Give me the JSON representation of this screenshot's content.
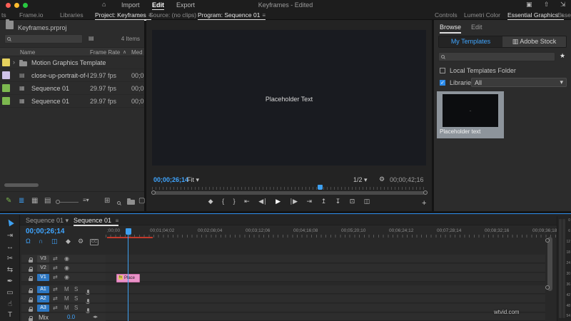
{
  "colors": {
    "accent_blue": "#2d8ceb",
    "timecode_blue": "#3fa5ff",
    "clip_pink": "#ea93c8",
    "fx_yellow": "#e3cf4e",
    "render_red": "#c0392b",
    "mac_close": "#ff5f57",
    "mac_minimize": "#febc2e",
    "mac_zoom": "#28c840",
    "label_yellow": "#e6d25e",
    "label_lavender": "#cfc3e8",
    "label_green": "#7cb84f"
  },
  "icons": {
    "home": "⌂",
    "workspaces": "▣",
    "quick_export": "⇧",
    "fullscreen": "⇲",
    "panel_menu": "≡",
    "overflow": "»",
    "caret_down": "▾",
    "caret_up": "∧",
    "disclosure": "›",
    "star": "★",
    "check": "✓",
    "wrench": "⚙",
    "plus": "+",
    "marker": "◆",
    "snap": "Ω",
    "linked_selection": "∩",
    "nest": "◫",
    "cc_badge": "CC",
    "eye": "◉",
    "sync_lock": "⇄",
    "kf_nav": "◂▸",
    "clip": "▤",
    "sequence": "▦",
    "filter": "▤",
    "stock": "▥"
  },
  "topbar": {
    "menu": [
      "Import",
      "Edit",
      "Export"
    ],
    "title": "Keyframes - Edited"
  },
  "panel_tabs": {
    "left": [
      "ts",
      "Frame.io",
      "Libraries",
      "Project: Keyframes"
    ],
    "center": [
      "Source: (no clips)",
      "Program: Sequence 01"
    ],
    "right": [
      "Controls",
      "Lumetri Color",
      "Essential Graphics",
      "Esse"
    ]
  },
  "project": {
    "filename": "Keyframes.prproj",
    "items_count": "4 Items",
    "columns": [
      "Name",
      "Frame Rate",
      "Med"
    ],
    "rows": [
      {
        "name": "Motion Graphics Template",
        "rate": "",
        "media": ""
      },
      {
        "name": "close-up-portrait-of-blue-an",
        "rate": "29.97 fps",
        "media": "00;0"
      },
      {
        "name": "Sequence 01",
        "rate": "29.97 fps",
        "media": "00;0"
      },
      {
        "name": "Sequence 01",
        "rate": "29.97 fps",
        "media": "00;0"
      }
    ],
    "footer_icons": [
      {
        "name": "project-writable",
        "glyph": "✎"
      },
      {
        "name": "list-view",
        "glyph": "≣"
      },
      {
        "name": "icon-view",
        "glyph": "▦"
      },
      {
        "name": "freeform-view",
        "glyph": "▤"
      },
      {
        "name": "sort",
        "glyph": "≡▾"
      },
      {
        "name": "automate-to-sequence",
        "glyph": "⊞"
      },
      {
        "name": "new-item",
        "glyph": "▢"
      }
    ]
  },
  "program": {
    "overlay_text": "Placeholder Text",
    "timecode": "00;00;26;14",
    "zoom_level": "Fit",
    "resolution": "1/2",
    "duration": "00;00;42;16",
    "transport": [
      {
        "name": "add-marker",
        "glyph": "◆"
      },
      {
        "name": "mark-in",
        "glyph": "{"
      },
      {
        "name": "mark-out",
        "glyph": "}"
      },
      {
        "name": "go-to-in",
        "glyph": "⇤"
      },
      {
        "name": "step-back",
        "glyph": "◀∣"
      },
      {
        "name": "play",
        "glyph": "▶"
      },
      {
        "name": "step-forward",
        "glyph": "∣▶"
      },
      {
        "name": "go-to-out",
        "glyph": "⇥"
      },
      {
        "name": "lift",
        "glyph": "↥"
      },
      {
        "name": "extract",
        "glyph": "↧"
      },
      {
        "name": "export-frame",
        "glyph": "⊡"
      },
      {
        "name": "comparison-view",
        "glyph": "◫"
      }
    ]
  },
  "graphics": {
    "tabs": [
      "Browse",
      "Edit"
    ],
    "my_templates": "My Templates",
    "adobe_stock": "Adobe Stock",
    "local_templates": "Local Templates Folder",
    "libraries_label": "Libraries",
    "libraries_value": "All",
    "thumb_text": "–",
    "template_caption": "Placeholder text"
  },
  "tools": [
    {
      "name": "selection-tool",
      "glyph": ""
    },
    {
      "name": "track-select-forward-tool",
      "glyph": "⇥"
    },
    {
      "name": "ripple-edit-tool",
      "glyph": "↔"
    },
    {
      "name": "razor-tool",
      "glyph": "✂"
    },
    {
      "name": "slip-tool",
      "glyph": "⇆"
    },
    {
      "name": "pen-tool",
      "glyph": "✒"
    },
    {
      "name": "rectangle-tool",
      "glyph": "▭"
    },
    {
      "name": "hand-tool",
      "glyph": "☝"
    },
    {
      "name": "type-tool",
      "glyph": "T"
    }
  ],
  "timeline": {
    "tabs": [
      "Sequence 01",
      "Sequence 01"
    ],
    "timecode": "00;00;26;14",
    "ruler": [
      ";00;00",
      "00;01;04;02",
      "00;02;08;04",
      "00;03;12;06",
      "00;04;16;08",
      "00;05;20;10",
      "00;06;24;12",
      "00;07;28;14",
      "00;08;32;16",
      "00;09;36;18"
    ],
    "video_tracks": [
      "V3",
      "V2",
      "V1"
    ],
    "audio_tracks": [
      "A1",
      "A2",
      "A3"
    ],
    "mute_label": "M",
    "solo_label": "S",
    "mix_label": "Mix",
    "mix_value": "0.0",
    "clip_label": "Place",
    "clip_fx": "fx",
    "meter_scale": [
      "0",
      "6",
      "12",
      "18",
      "24",
      "30",
      "36",
      "42",
      "48",
      "54"
    ]
  },
  "watermark": "wtvid.com"
}
